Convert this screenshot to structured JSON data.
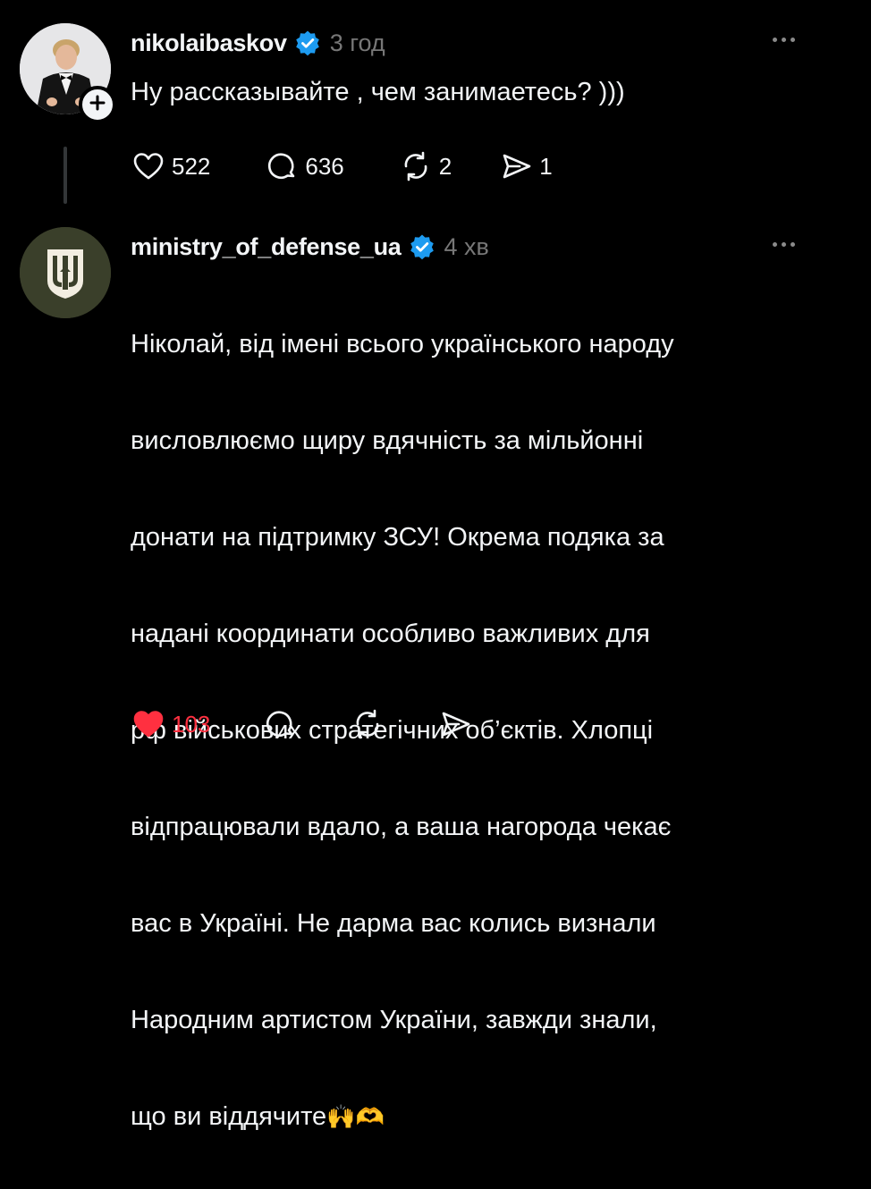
{
  "posts": [
    {
      "username": "nikolaibaskov",
      "time": "3 год",
      "text": "Ну рассказывайте , чем занимаетесь? )))",
      "likes": "522",
      "comments": "636",
      "reposts": "2",
      "shares": "1",
      "verified": true,
      "liked": false,
      "follow_badge": "+"
    },
    {
      "username": "ministry_of_defense_ua",
      "time": "4 хв",
      "text_lines": [
        "Ніколай, від імені всього українського народу",
        "висловлюємо щиру вдячність за мільйонні",
        "донати на підтримку ЗСУ! Окрема подяка за",
        "надані координати особливо важливих для",
        "рф військових стратегічних об’єктів. Хлопці",
        "відпрацювали вдало, а ваша нагорода чекає",
        "вас в Україні. Не дарма вас колись визнали",
        "Народним артистом України, завжди знали,",
        "що ви віддячите"
      ],
      "text_emoji": "🙌🫶",
      "likes": "103",
      "verified": true,
      "liked": true
    }
  ],
  "colors": {
    "background": "#000000",
    "text": "#f3f5f7",
    "muted": "#777777",
    "verified": "#1d9bf0",
    "like_red": "#ff3040",
    "mod_avatar_bg": "#3a3f2a"
  },
  "icons": [
    "verified-badge-icon",
    "more-options-icon",
    "heart-icon",
    "comment-icon",
    "repost-icon",
    "share-icon",
    "plus-icon",
    "trident-emblem-icon"
  ]
}
